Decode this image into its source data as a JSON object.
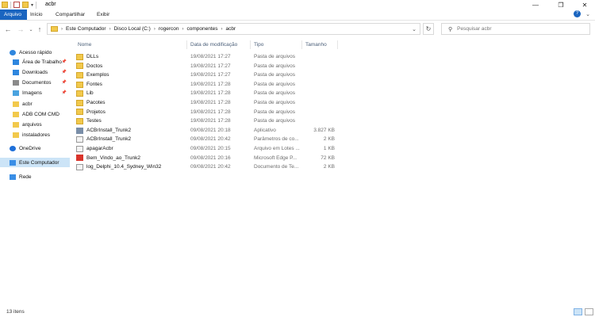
{
  "window": {
    "title": "acbr",
    "controls": {
      "minimize": "—",
      "maximize": "❐",
      "close": "✕"
    }
  },
  "ribbon": {
    "tabs": [
      "Arquivo",
      "Início",
      "Compartilhar",
      "Exibir"
    ],
    "active_tab": "Arquivo"
  },
  "nav": {
    "back_icon": "arrow-left-icon",
    "forward_icon": "arrow-right-icon",
    "recent_icon": "chevron-down-icon",
    "up_icon": "arrow-up-icon"
  },
  "address": {
    "crumbs": [
      "Este Computador",
      "Disco Local (C:)",
      "rogercon",
      "componentes",
      "acbr"
    ]
  },
  "search": {
    "placeholder": "Pesquisar acbr"
  },
  "sidebar": {
    "items": [
      {
        "label": "Acesso rápido",
        "icon": "star-icon",
        "color": "#2e86de",
        "pinned": false
      },
      {
        "label": "Área de Trabalho",
        "icon": "desktop-icon",
        "color": "#2e86de",
        "pinned": true
      },
      {
        "label": "Downloads",
        "icon": "download-icon",
        "color": "#2e86de",
        "pinned": true
      },
      {
        "label": "Documentos",
        "icon": "document-icon",
        "color": "#8a8a8a",
        "pinned": true
      },
      {
        "label": "Imagens",
        "icon": "image-icon",
        "color": "#4aa3df",
        "pinned": true
      },
      {
        "label": "acbr",
        "icon": "folder-icon",
        "color": "#f2c94c",
        "pinned": false
      },
      {
        "label": "ADB COM CMD",
        "icon": "folder-icon",
        "color": "#f2c94c",
        "pinned": false
      },
      {
        "label": "arquivos",
        "icon": "folder-icon",
        "color": "#f2c94c",
        "pinned": false
      },
      {
        "label": "instaladores",
        "icon": "folder-icon",
        "color": "#f2c94c",
        "pinned": false
      },
      {
        "label": "OneDrive",
        "icon": "cloud-icon",
        "color": "#1e6fd9",
        "pinned": false
      },
      {
        "label": "Este Computador",
        "icon": "computer-icon",
        "color": "#3a8ee6",
        "pinned": false,
        "selected": true
      },
      {
        "label": "Rede",
        "icon": "network-icon",
        "color": "#3a8ee6",
        "pinned": false
      }
    ]
  },
  "columns": {
    "name": "Nome",
    "date": "Data de modificação",
    "type": "Tipo",
    "size": "Tamanho"
  },
  "files": [
    {
      "name": "DLLs",
      "date": "19/08/2021 17:27",
      "type": "Pasta de arquivos",
      "size": "",
      "icon": "folder-icon"
    },
    {
      "name": "Doctos",
      "date": "19/08/2021 17:27",
      "type": "Pasta de arquivos",
      "size": "",
      "icon": "folder-icon"
    },
    {
      "name": "Exemplos",
      "date": "19/08/2021 17:27",
      "type": "Pasta de arquivos",
      "size": "",
      "icon": "folder-icon"
    },
    {
      "name": "Fontes",
      "date": "19/08/2021 17:28",
      "type": "Pasta de arquivos",
      "size": "",
      "icon": "folder-icon"
    },
    {
      "name": "Lib",
      "date": "19/08/2021 17:28",
      "type": "Pasta de arquivos",
      "size": "",
      "icon": "folder-icon"
    },
    {
      "name": "Pacotes",
      "date": "19/08/2021 17:28",
      "type": "Pasta de arquivos",
      "size": "",
      "icon": "folder-icon"
    },
    {
      "name": "Projetos",
      "date": "19/08/2021 17:28",
      "type": "Pasta de arquivos",
      "size": "",
      "icon": "folder-icon"
    },
    {
      "name": "Testes",
      "date": "19/08/2021 17:28",
      "type": "Pasta de arquivos",
      "size": "",
      "icon": "folder-icon"
    },
    {
      "name": "ACBrInstall_Trunk2",
      "date": "09/08/2021 20:18",
      "type": "Aplicativo",
      "size": "3.827 KB",
      "icon": "application-icon"
    },
    {
      "name": "ACBrInstall_Trunk2",
      "date": "09/08/2021 20:42",
      "type": "Parâmetros de co...",
      "size": "2 KB",
      "icon": "settings-file-icon"
    },
    {
      "name": "apagarAcbr",
      "date": "09/08/2021 20:15",
      "type": "Arquivo em Lotes ...",
      "size": "1 KB",
      "icon": "batch-file-icon"
    },
    {
      "name": "Bem_Vindo_ao_Trunk2",
      "date": "09/08/2021 20:16",
      "type": "Microsoft Edge P...",
      "size": "72 KB",
      "icon": "pdf-icon"
    },
    {
      "name": "log_Delphi_10.4_Sydney_Win32",
      "date": "09/08/2021 20:42",
      "type": "Documento de Te...",
      "size": "2 KB",
      "icon": "text-file-icon"
    }
  ],
  "status": {
    "count": "13 itens"
  },
  "colors": {
    "accent": "#1a65c0",
    "selected": "#cce4f7",
    "folder": "#f2c94c"
  }
}
